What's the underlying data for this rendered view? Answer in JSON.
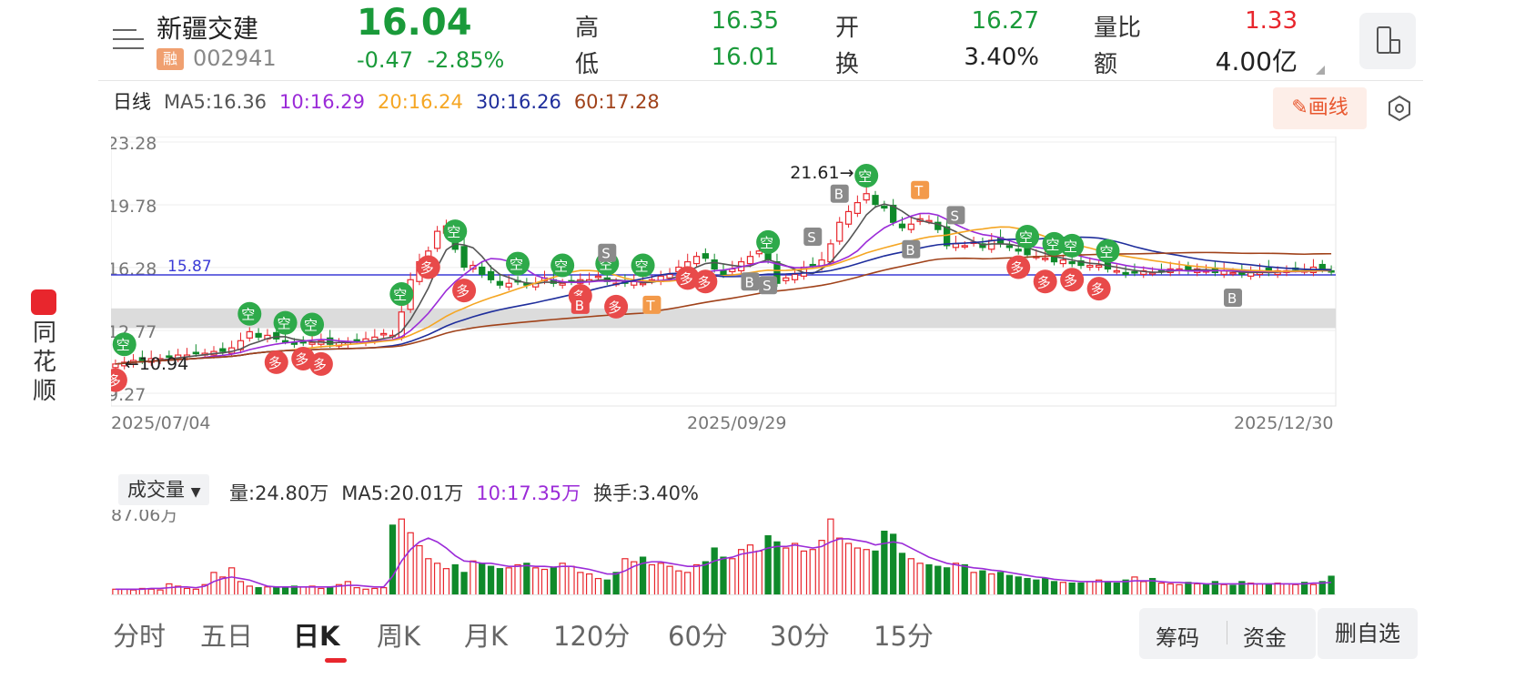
{
  "stock": {
    "name": "新疆交建",
    "badge": "融",
    "code": "002941",
    "price": "16.04",
    "change": "-0.47",
    "change_pct": "-2.85%"
  },
  "quote": {
    "high_label": "高",
    "high": "16.35",
    "low_label": "低",
    "low": "16.01",
    "open_label": "开",
    "open": "16.27",
    "turnover_label": "换",
    "turnover": "3.40%",
    "vol_ratio_label": "量比",
    "vol_ratio": "1.33",
    "amount_label": "额",
    "amount": "4.00亿"
  },
  "ma": {
    "period": "日线",
    "ma5": "MA5:16.36",
    "ma10": "10:16.29",
    "ma20": "20:16.24",
    "ma30": "30:16.26",
    "ma60": "60:17.28"
  },
  "colors": {
    "up": "#e8262d",
    "down": "#0f8a2a",
    "ma5": "#555555",
    "ma10": "#9b2bd8",
    "ma20": "#f5a623",
    "ma30": "#1f2e9c",
    "ma60": "#a0421a"
  },
  "draw_button": "画线",
  "brand_text": "同花顺",
  "chart_data": {
    "type": "candlestick",
    "y_ticks": [
      "23.28",
      "19.78",
      "16.28",
      "12.77",
      "9.27"
    ],
    "ylim": [
      9.27,
      23.28
    ],
    "x_ticks": [
      "2025/07/04",
      "2025/09/29",
      "2025/12/30"
    ],
    "reference_line": "15.87",
    "high_annotation": "21.61",
    "low_annotation": "10.94",
    "close": [
      10.9,
      11.0,
      11.1,
      11.1,
      11.2,
      11.2,
      11.3,
      11.4,
      11.4,
      11.5,
      11.5,
      11.6,
      11.6,
      11.8,
      12.2,
      12.7,
      12.4,
      12.5,
      12.3,
      12.2,
      12.0,
      12.1,
      12.1,
      12.2,
      12.0,
      12.1,
      12.1,
      12.2,
      12.3,
      12.4,
      12.6,
      12.5,
      13.8,
      15.6,
      16.6,
      17.2,
      18.3,
      18.6,
      17.3,
      16.3,
      16.4,
      15.9,
      15.6,
      15.3,
      15.4,
      15.5,
      15.3,
      15.4,
      15.7,
      15.4,
      15.4,
      15.5,
      15.6,
      15.6,
      15.8,
      15.5,
      15.4,
      15.4,
      15.5,
      15.4,
      15.6,
      15.8,
      15.9,
      16.3,
      16.6,
      16.9,
      16.8,
      16.2,
      15.9,
      16.2,
      16.6,
      16.9,
      17.2,
      16.7,
      15.4,
      15.7,
      15.9,
      16.3,
      16.4,
      16.7,
      17.6,
      18.8,
      19.4,
      19.9,
      20.4,
      19.8,
      19.6,
      18.8,
      18.5,
      18.7,
      19.0,
      18.9,
      18.4,
      17.5,
      17.6,
      17.5,
      17.7,
      17.4,
      17.8,
      17.6,
      17.4,
      17.2,
      17.0,
      16.9,
      16.8,
      16.6,
      16.7,
      16.5,
      16.4,
      16.4,
      16.4,
      16.2,
      16.1,
      15.9,
      16.0,
      16.1,
      16.0,
      16.1,
      16.2,
      16.2,
      16.1,
      16.2,
      16.1,
      16.0,
      16.1,
      16.0,
      15.9,
      16.0,
      16.1,
      16.0,
      16.1,
      16.1,
      16.2,
      16.1,
      16.3,
      16.2,
      16.04
    ],
    "up_markers": [
      "多",
      "多",
      "多",
      "多",
      "多",
      "多",
      "多",
      "多",
      "多",
      "多",
      "多",
      "多",
      "多",
      "多"
    ],
    "down_markers": [
      "空",
      "空",
      "空",
      "空",
      "空",
      "空",
      "空",
      "空",
      "空",
      "空",
      "空",
      "空",
      "空",
      "空",
      "空",
      "空"
    ],
    "trade_markers": [
      "B",
      "S",
      "B",
      "S",
      "S",
      "B",
      "B",
      "S",
      "T",
      "T",
      "B"
    ]
  },
  "volume": {
    "selector": "成交量",
    "vol": "量:24.80万",
    "ma5": "MA5:20.01万",
    "ma10": "10:17.35万",
    "turnover": "换手:3.40%",
    "y_tick": "87.06万",
    "values": [
      8,
      8,
      7,
      9,
      8,
      7,
      15,
      12,
      9,
      8,
      14,
      30,
      24,
      36,
      18,
      12,
      10,
      11,
      10,
      10,
      12,
      11,
      12,
      9,
      11,
      14,
      18,
      10,
      8,
      9,
      10,
      92,
      100,
      82,
      65,
      48,
      42,
      35,
      40,
      30,
      45,
      42,
      38,
      35,
      36,
      40,
      42,
      36,
      34,
      36,
      42,
      38,
      30,
      28,
      22,
      20,
      30,
      48,
      44,
      50,
      40,
      42,
      38,
      32,
      30,
      40,
      44,
      62,
      50,
      48,
      60,
      66,
      58,
      78,
      70,
      62,
      68,
      58,
      60,
      72,
      100,
      75,
      68,
      62,
      60,
      58,
      84,
      80,
      55,
      48,
      42,
      40,
      38,
      36,
      42,
      40,
      30,
      32,
      28,
      30,
      26,
      24,
      22,
      20,
      22,
      18,
      17,
      16,
      16,
      18,
      20,
      17,
      16,
      20,
      24,
      18,
      22,
      16,
      15,
      14,
      17,
      15,
      14,
      18,
      14,
      13,
      18,
      16,
      15,
      14,
      16,
      15,
      14,
      17,
      14,
      18,
      25
    ],
    "ma_line": [
      8,
      8,
      8,
      8,
      9,
      9,
      10,
      11,
      11,
      10,
      12,
      18,
      22,
      24,
      22,
      20,
      16,
      12,
      11,
      11,
      11,
      11,
      11,
      11,
      11,
      12,
      13,
      13,
      12,
      11,
      11,
      25,
      45,
      60,
      70,
      75,
      70,
      62,
      52,
      45,
      44,
      42,
      42,
      40,
      38,
      38,
      39,
      38,
      38,
      37,
      38,
      38,
      36,
      34,
      31,
      28,
      28,
      32,
      38,
      42,
      44,
      44,
      42,
      40,
      38,
      38,
      40,
      45,
      48,
      50,
      54,
      56,
      58,
      62,
      64,
      64,
      66,
      64,
      62,
      64,
      70,
      74,
      74,
      72,
      70,
      66,
      68,
      70,
      68,
      62,
      56,
      50,
      46,
      42,
      40,
      38,
      36,
      35,
      33,
      32,
      30,
      28,
      26,
      24,
      23,
      21,
      20,
      19,
      18,
      18,
      18,
      18,
      18,
      18,
      19,
      19,
      19,
      18,
      17,
      17,
      16,
      16,
      15,
      15,
      15,
      15,
      15,
      15,
      15,
      15,
      15,
      15,
      15,
      15,
      16,
      16,
      17
    ]
  },
  "tabs": [
    "分时",
    "五日",
    "日K",
    "周K",
    "月K",
    "120分",
    "60分",
    "30分",
    "15分"
  ],
  "active_tab": "日K",
  "buttons": {
    "chips": "筹码",
    "funds": "资金",
    "remove": "删自选"
  }
}
